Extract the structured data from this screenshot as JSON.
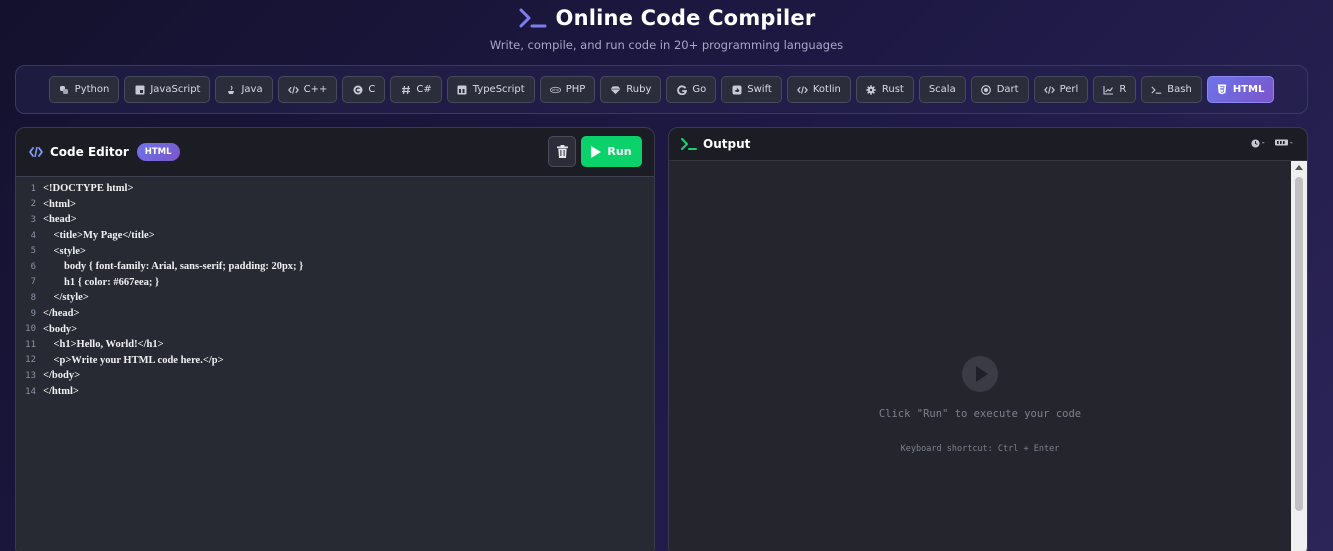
{
  "header": {
    "title": "Online Code Compiler",
    "subtitle": "Write, compile, and run code in 20+ programming languages"
  },
  "languages": [
    {
      "label": "Python",
      "icon": "python-icon"
    },
    {
      "label": "JavaScript",
      "icon": "javascript-icon"
    },
    {
      "label": "Java",
      "icon": "java-icon"
    },
    {
      "label": "C++",
      "icon": "code-icon"
    },
    {
      "label": "C",
      "icon": "c-icon"
    },
    {
      "label": "C#",
      "icon": "hash-icon"
    },
    {
      "label": "TypeScript",
      "icon": "typescript-icon"
    },
    {
      "label": "PHP",
      "icon": "php-icon"
    },
    {
      "label": "Ruby",
      "icon": "gem-icon"
    },
    {
      "label": "Go",
      "icon": "go-icon"
    },
    {
      "label": "Swift",
      "icon": "swift-icon"
    },
    {
      "label": "Kotlin",
      "icon": "code-icon"
    },
    {
      "label": "Rust",
      "icon": "gear-icon"
    },
    {
      "label": "Scala",
      "icon": ""
    },
    {
      "label": "Dart",
      "icon": "target-icon"
    },
    {
      "label": "Perl",
      "icon": "code-icon"
    },
    {
      "label": "R",
      "icon": "chart-icon"
    },
    {
      "label": "Bash",
      "icon": "terminal-icon"
    },
    {
      "label": "HTML",
      "icon": "html5-icon",
      "active": true
    }
  ],
  "editor": {
    "title": "Code Editor",
    "badge": "HTML",
    "run_label": "Run",
    "lines": [
      "<!DOCTYPE html>",
      "<html>",
      "<head>",
      "    <title>My Page</title>",
      "    <style>",
      "        body { font-family: Arial, sans-serif; padding: 20px; }",
      "        h1 { color: #667eea; }",
      "    </style>",
      "</head>",
      "<body>",
      "    <h1>Hello, World!</h1>",
      "    <p>Write your HTML code here.</p>",
      "</body>",
      "</html>"
    ]
  },
  "output": {
    "title": "Output",
    "time": "-",
    "memory": "-",
    "empty_message": "Click \"Run\" to execute your code",
    "shortcut": "Keyboard shortcut: Ctrl + Enter"
  },
  "colors": {
    "accent": "#6d74ea",
    "run_green": "#0bd16a",
    "brand_purple": "#7b55c9"
  }
}
